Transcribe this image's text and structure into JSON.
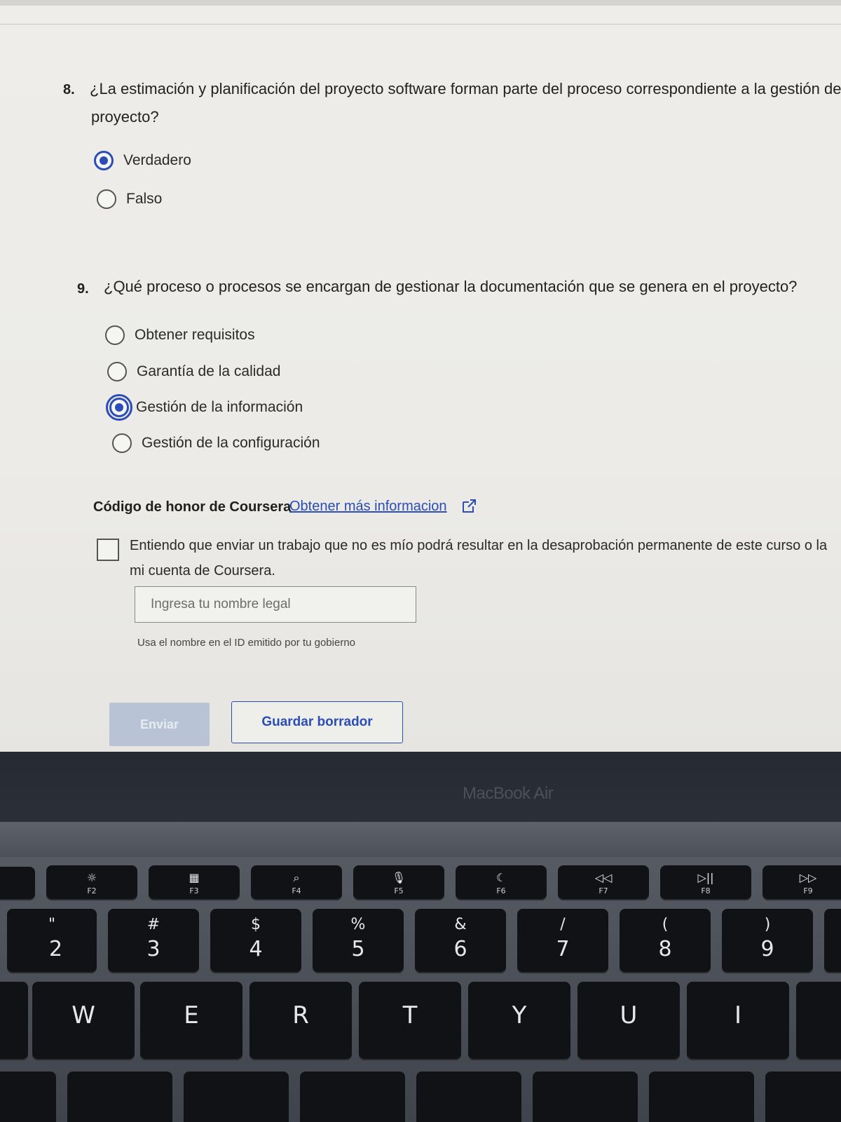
{
  "quiz": {
    "q8": {
      "number": "8.",
      "text_line1": "¿La estimación y planificación del proyecto software forman parte del proceso correspondiente a la gestión de",
      "text_line2": "proyecto?",
      "options": [
        {
          "label": "Verdadero",
          "selected": true
        },
        {
          "label": "Falso",
          "selected": false
        }
      ]
    },
    "q9": {
      "number": "9.",
      "text": "¿Qué proceso o procesos se encargan de gestionar la documentación que se genera en el proyecto?",
      "options": [
        {
          "label": "Obtener requisitos",
          "selected": false
        },
        {
          "label": "Garantía de la calidad",
          "selected": false
        },
        {
          "label": "Gestión de la información",
          "selected": true
        },
        {
          "label": "Gestión de la configuración",
          "selected": false
        }
      ]
    },
    "honor": {
      "title": "Código de honor de Coursera",
      "link": "Obtener más informacion",
      "checkbox_text_line1": "Entiendo que enviar un trabajo que no es mío podrá resultar en la desaprobación permanente de este curso o la",
      "checkbox_text_line2": "mi cuenta de Coursera.",
      "checked": false,
      "name_placeholder": "Ingresa tu nombre legal",
      "name_value": "",
      "name_hint": "Usa el nombre en el ID emitido por tu gobierno"
    },
    "buttons": {
      "submit": "Enviar",
      "draft": "Guardar borrador"
    }
  },
  "device": {
    "brand": "MacBook Air"
  },
  "keyboard": {
    "fn_row": [
      {
        "icon": "☼",
        "label": "F2"
      },
      {
        "icon": "▦",
        "label": "F3"
      },
      {
        "icon": "⌕",
        "label": "F4"
      },
      {
        "icon": "🎙",
        "label": "F5"
      },
      {
        "icon": "☾",
        "label": "F6"
      },
      {
        "icon": "◁◁",
        "label": "F7"
      },
      {
        "icon": "▷||",
        "label": "F8"
      },
      {
        "icon": "▷▷",
        "label": "F9"
      }
    ],
    "num_row": [
      {
        "sym": "\"",
        "num": "2"
      },
      {
        "sym": "#",
        "num": "3"
      },
      {
        "sym": "$",
        "num": "4"
      },
      {
        "sym": "%",
        "num": "5"
      },
      {
        "sym": "&",
        "num": "6"
      },
      {
        "sym": "/",
        "num": "7"
      },
      {
        "sym": "(",
        "num": "8"
      },
      {
        "sym": ")",
        "num": "9"
      }
    ],
    "letter_row": [
      "W",
      "E",
      "R",
      "T",
      "Y",
      "U",
      "I"
    ]
  },
  "colors": {
    "accent": "#2b4db5",
    "submit_disabled": "#b8c4d6",
    "screen_bg": "#eeedea"
  }
}
